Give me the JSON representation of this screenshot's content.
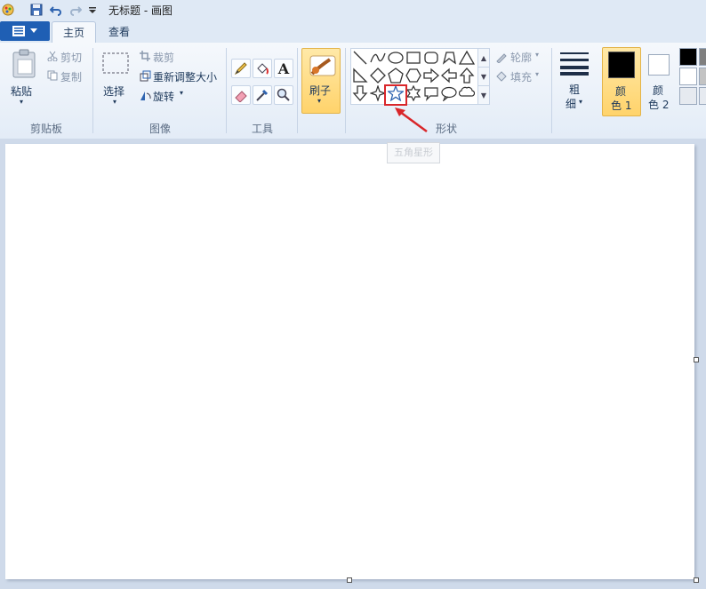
{
  "window": {
    "title": "无标题 - 画图"
  },
  "tabs": [
    {
      "label": "主页"
    },
    {
      "label": "查看"
    }
  ],
  "clipboard": {
    "paste": "粘贴",
    "cut": "剪切",
    "copy": "复制",
    "group": "剪贴板"
  },
  "image": {
    "select": "选择",
    "crop": "裁剪",
    "resize": "重新调整大小",
    "rotate": "旋转",
    "group": "图像"
  },
  "tools": {
    "group": "工具"
  },
  "brushes": {
    "label": "刷子"
  },
  "shapes": {
    "outline": "轮廓",
    "fill": "填充",
    "group": "形状",
    "tooltip": "五角星形"
  },
  "size": {
    "line1": "粗",
    "line2": "细"
  },
  "colors": {
    "color1_line1": "颜",
    "color1_line2": "色 1",
    "color2_line1": "颜",
    "color2_line2": "色 2",
    "color1": "#000000",
    "color2": "#ffffff",
    "palette": [
      "#000000",
      "#7f7f7f",
      "#ffffff",
      "#c3c3c3"
    ]
  },
  "accent": {
    "highlight": "#d9262a",
    "active_tool": "#ffd36b"
  }
}
